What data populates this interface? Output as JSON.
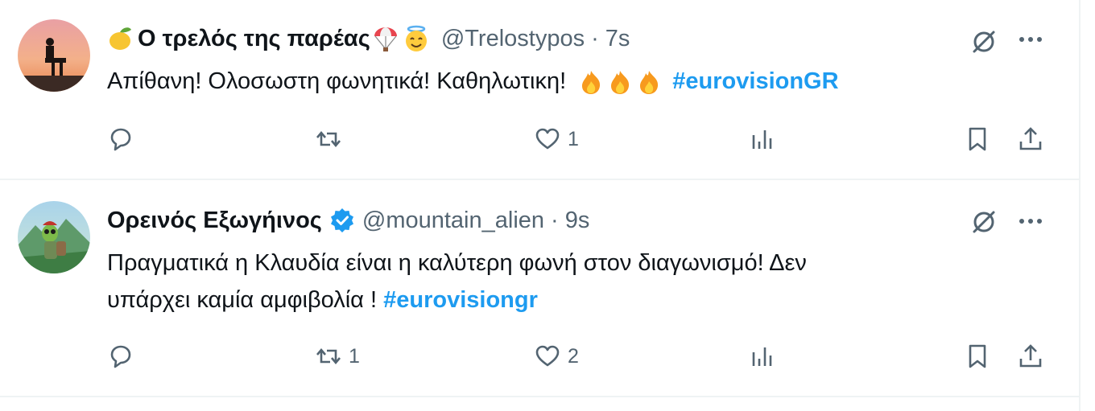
{
  "tweets": [
    {
      "display_name": "Ο τρελός της παρέας",
      "handle": "@Trelostypos",
      "separator": "·",
      "time": "7s",
      "verified": false,
      "name_emojis": [
        "lemon-emoji",
        "parachute-emoji",
        "smiling-face-with-halo-emoji"
      ],
      "text": "Απίθανη! Ολοσωστη φωνητικά! Καθηλωτικη!",
      "text_emojis": [
        "fire-emoji",
        "fire-emoji",
        "fire-emoji"
      ],
      "hashtag": "#eurovisionGR",
      "replies": "",
      "reposts": "",
      "likes": "1",
      "views": ""
    },
    {
      "display_name": "Ορεινός Εξωγήινος",
      "handle": "@mountain_alien",
      "separator": "·",
      "time": "9s",
      "verified": true,
      "text_line1": "Πραγματικά η Κλαυδία είναι η καλύτερη φωνή στον διαγωνισμό! Δεν",
      "text_line2": "υπάρχει καμία αμφιβολία !",
      "hashtag": "#eurovisiongr",
      "replies": "",
      "reposts": "1",
      "likes": "2",
      "views": ""
    }
  ],
  "colors": {
    "text": "#0f1419",
    "secondary": "#536471",
    "link": "#1d9bf0",
    "divider": "#eff3f4",
    "verified": "#1d9bf0"
  },
  "icons": [
    "grok-icon",
    "more-icon",
    "reply-icon",
    "repost-icon",
    "like-icon",
    "views-icon",
    "bookmark-icon",
    "share-icon"
  ]
}
